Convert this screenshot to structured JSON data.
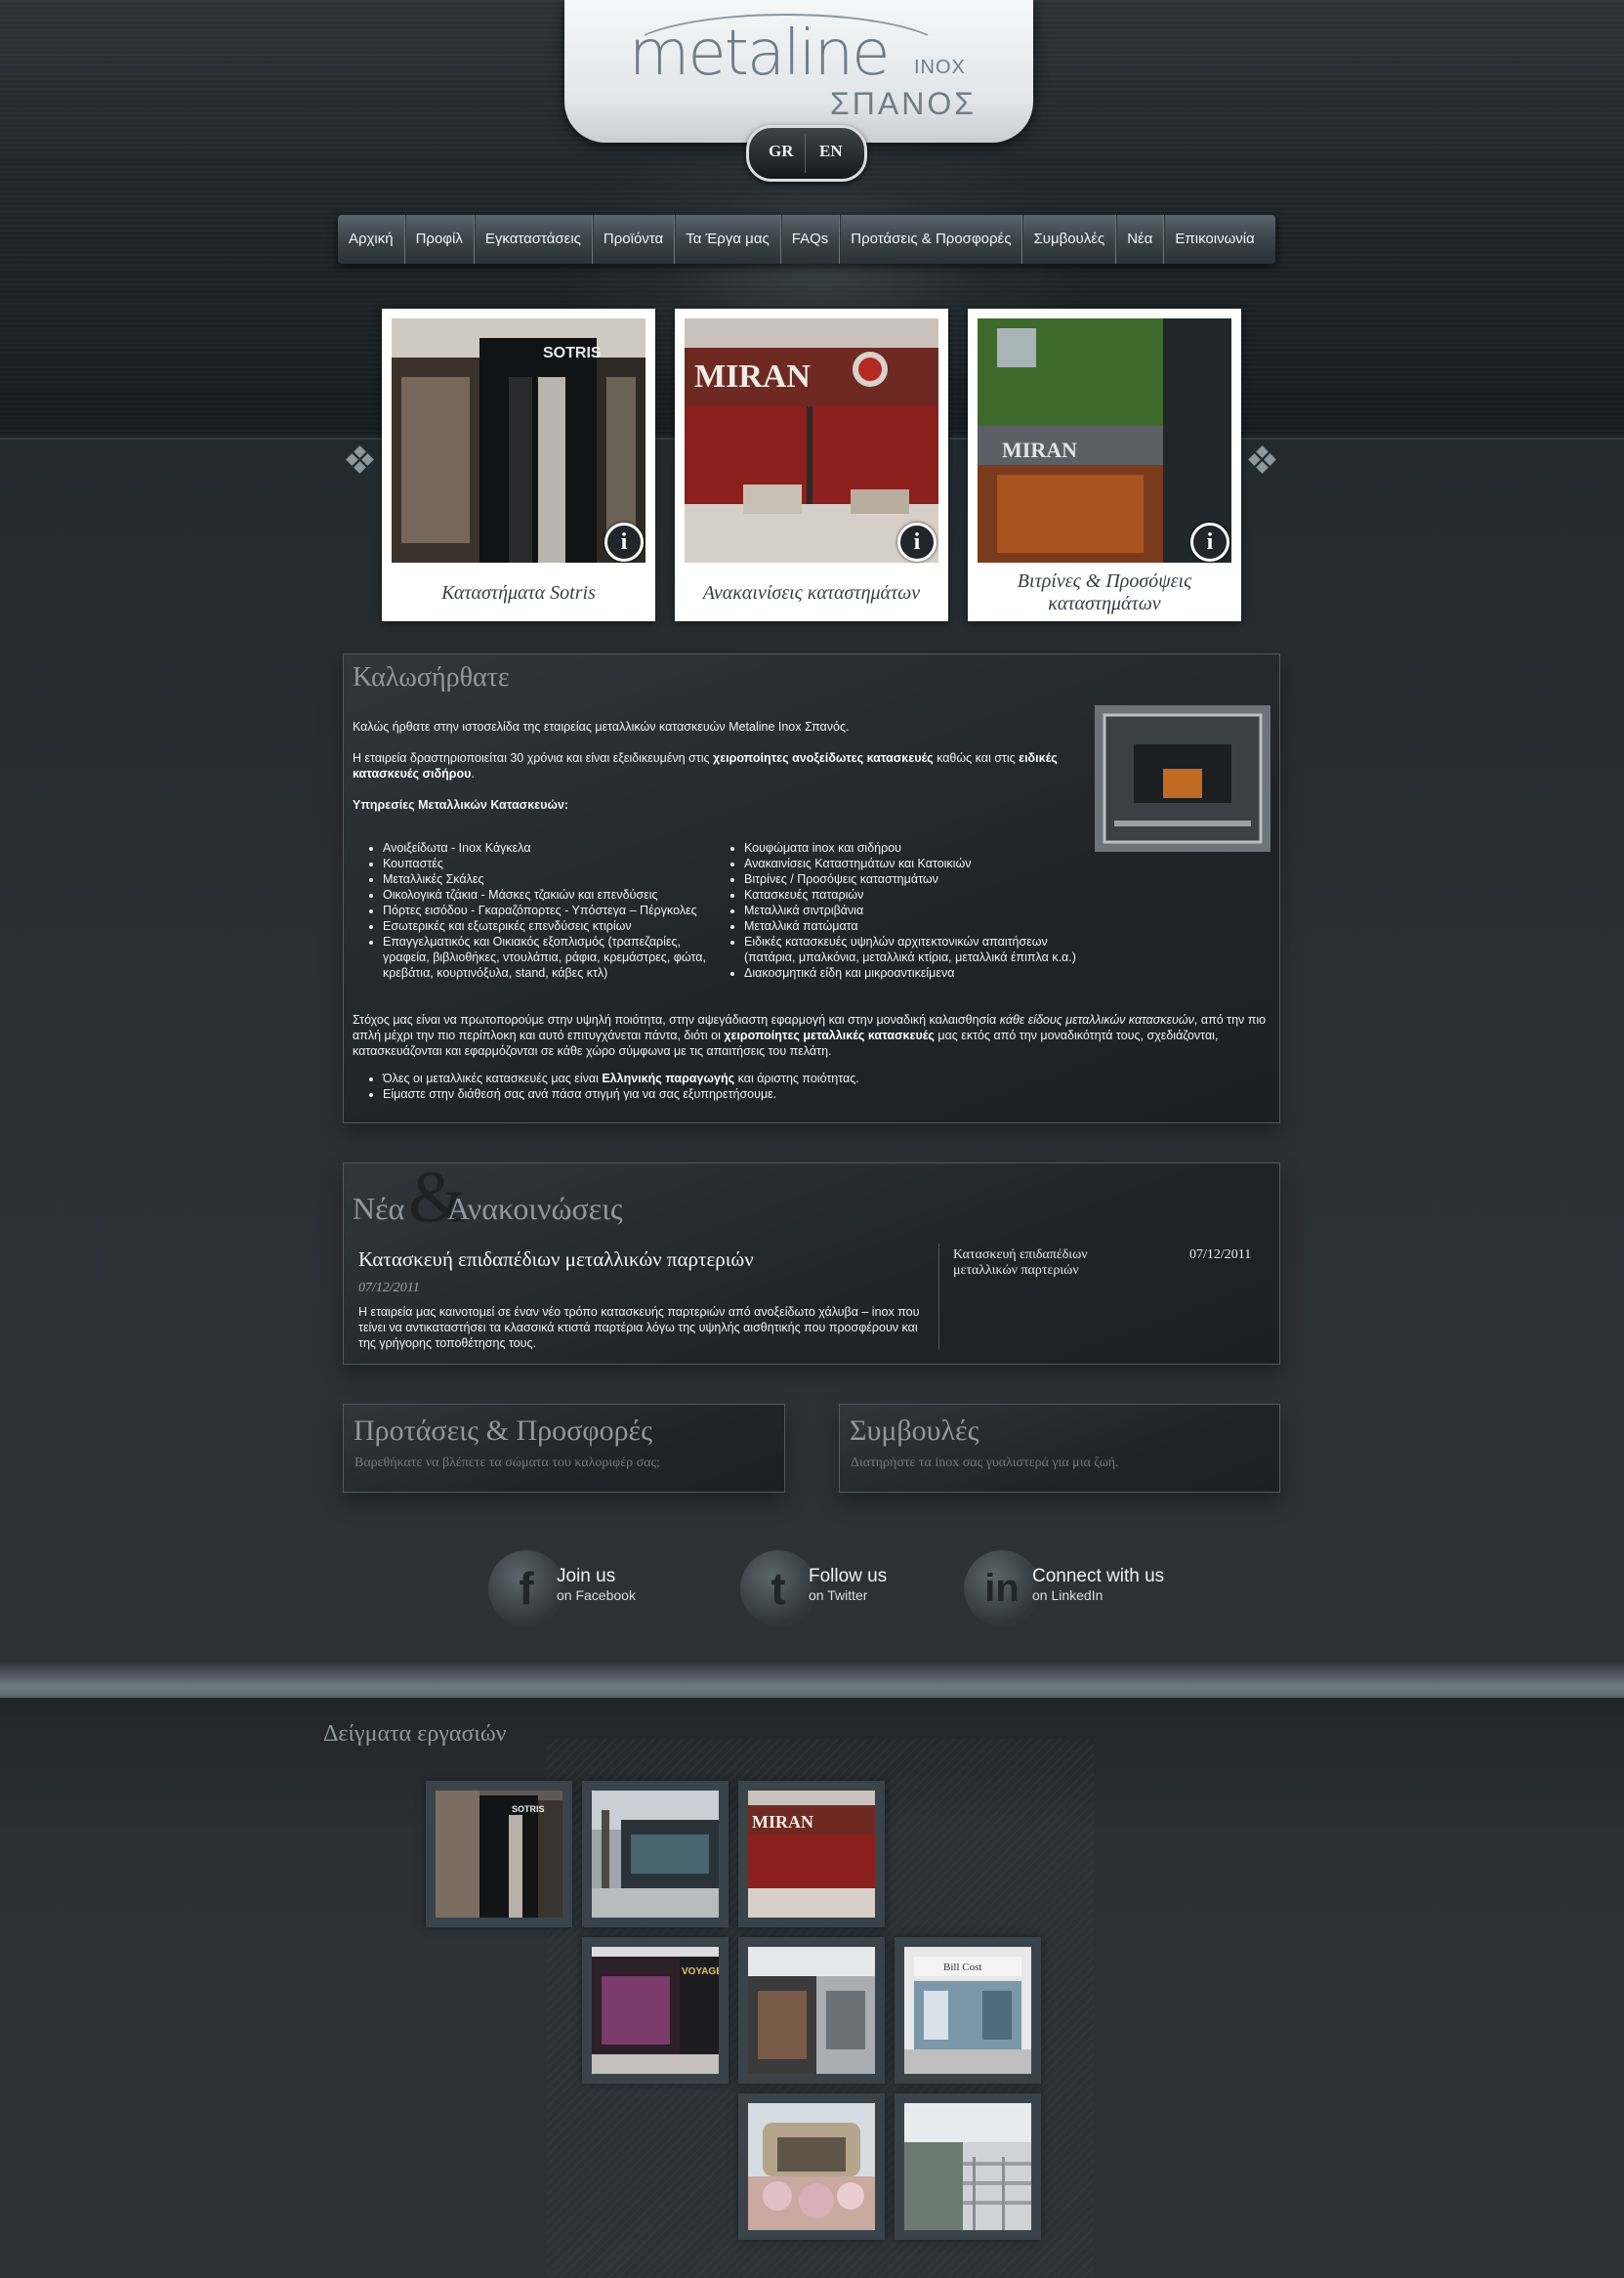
{
  "brand": {
    "logo_main": "metaline",
    "logo_inox": "INOX",
    "logo_sub": "ΣΠΑΝΟΣ"
  },
  "language": {
    "gr": "GR",
    "en": "EN"
  },
  "nav": {
    "items": [
      {
        "label": "Αρχική"
      },
      {
        "label": "Προφίλ"
      },
      {
        "label": "Εγκαταστάσεις"
      },
      {
        "label": "Προϊόντα"
      },
      {
        "label": "Τα Έργα μας"
      },
      {
        "label": "FAQs"
      },
      {
        "label": "Προτάσεις & Προσφορές"
      },
      {
        "label": "Συμβουλές"
      },
      {
        "label": "Νέα"
      },
      {
        "label": "Επικοινωνία"
      }
    ]
  },
  "features": [
    {
      "caption": "Καταστήματα Sotris",
      "image": "sotris-storefront"
    },
    {
      "caption": "Ανακαινίσεις καταστημάτων",
      "image": "miran-shop-interior"
    },
    {
      "caption": "Βιτρίνες & Προσόψεις καταστημάτων",
      "image": "miran-green-facade"
    }
  ],
  "welcome": {
    "title": "Καλωσήρθατε",
    "intro": "Καλώς ήρθατε στην ιστοσελίδα της εταιρείας μεταλλικών κατασκευών Metaline Inox Σπανός.",
    "activity_a": "Η εταιρεία δραστηριοποιείται 30 χρόνια και είναι εξειδικευμένη στις ",
    "activity_b": "χειροποίητες ανοξείδωτες κατασκευές",
    "activity_c": " καθώς και στις ",
    "activity_d": "ειδικές κατασκευές σιδήρου",
    "activity_e": ".",
    "services_heading": "Υπηρεσίες Μεταλλικών Κατασκευών:",
    "services_left": [
      "Ανοιξείδωτα - Inox Κάγκελα",
      "Κουπαστές",
      "Μεταλλικές Σκάλες",
      "Οικολογικά τζάκια - Μάσκες τζακιών και επενδύσεις",
      "Πόρτες εισόδου - Γκαραζόπορτες - Υπόστεγα – Πέργκολες",
      "Εσωτερικές και εξωτερικές επενδύσεις κτιρίων",
      "Επαγγελματικός και Οικιακός εξοπλισμός (τραπεζαρίες, γραφεία, βιβλιοθήκες, ντουλάπια, ράφια, κρεμάστρες, φώτα, κρεβάτια, κουρτινόξυλα, stand, κάβες κτλ)"
    ],
    "services_right": [
      "Κουφώματα inox και σιδήρου",
      "Ανακαινίσεις Καταστημάτων και Κατοικιών",
      "Βιτρίνες / Προσόψεις καταστημάτων",
      "Κατασκευές παταριών",
      "Μεταλλικά σιντριβάνια",
      "Μεταλλικά πατώματα",
      "Ειδικές κατασκευές υψηλών αρχιτεκτονικών απαιτήσεων (πατάρια, μπαλκόνια, μεταλλικά κτίρια, μεταλλικά έπιπλα κ.α.)",
      "Διακοσμητικά είδη και μικροαντικείμενα"
    ],
    "goal_a": "Στόχος μας  είναι να πρωτοπορούμε στην υψηλή  ποιότητα, στην αψεγάδιαστη εφαρμογή και στην μοναδική καλαισθησία ",
    "goal_b": "κάθε είδους μεταλλικών κατασκευών",
    "goal_c": ", από την πιο απλή μέχρι την πιο περίπλοκη και αυτό επιτυγχάνεται πάντα, διότι οι  ",
    "goal_d": "χειροποίητες μεταλλικές κατασκευές",
    "goal_e": " μας εκτός από την μοναδικότητά τους, σχεδιάζονται, κατασκευάζονται και εφαρμόζονται σε κάθε χώρο σύμφωνα με τις απαιτήσεις του πελάτη.",
    "bullet1_a": "Όλες οι μεταλλικές κατασκευές μας είναι ",
    "bullet1_b": "Ελληνικής παραγωγής",
    "bullet1_c": " και άριστης ποιότητας.",
    "bullet2": "Είμαστε στην διάθεσή σας ανά πάσα στιγμή για να σας εξυπηρετήσουμε."
  },
  "news": {
    "title_a": "Νέα",
    "title_amp": "&",
    "title_b": "Ανακοινώσεις",
    "headline": "Κατασκευή επιδαπέδιων μεταλλικών παρτεριών",
    "date": "07/12/2011",
    "body": "Η εταιρεία μας καινοτομεί σε έναν νέο τρόπο κατασκευής παρτεριών από ανοξείδωτο χάλυβα – inox που τείνει να αντικαταστήσει τα κλασσικά κτιστά παρτέρια λόγω της υψηλής αισθητικής που προσφέρουν και της γρήγορης τοποθέτησης τους.",
    "side_title": "Κατασκευή επιδαπέδιων μεταλλικών παρτεριών",
    "side_date": "07/12/2011"
  },
  "offers": {
    "title": "Προτάσεις & Προσφορές",
    "text": "Βαρεθήκατε να βλέπετε τα σώματα του καλοριφέρ σας;"
  },
  "advice": {
    "title": "Συμβουλές",
    "text": "Διατηρήστε τα inox σας γυαλιστερά για μια ζωή."
  },
  "social": [
    {
      "line1": "Join us",
      "line2": "on Facebook",
      "icon": "facebook-icon",
      "glyph": "f"
    },
    {
      "line1": "Follow us",
      "line2": "on Twitter",
      "icon": "twitter-icon",
      "glyph": "t"
    },
    {
      "line1": "Connect with us",
      "line2": "on LinkedIn",
      "icon": "linkedin-icon",
      "glyph": "in"
    }
  ],
  "samples": {
    "title": "Δείγματα εργασιών"
  },
  "colors": {
    "background": "#232a2e",
    "panel_border": "#4f595f",
    "nav_bar": "#3a444a",
    "title_gray": "#8e999f"
  }
}
